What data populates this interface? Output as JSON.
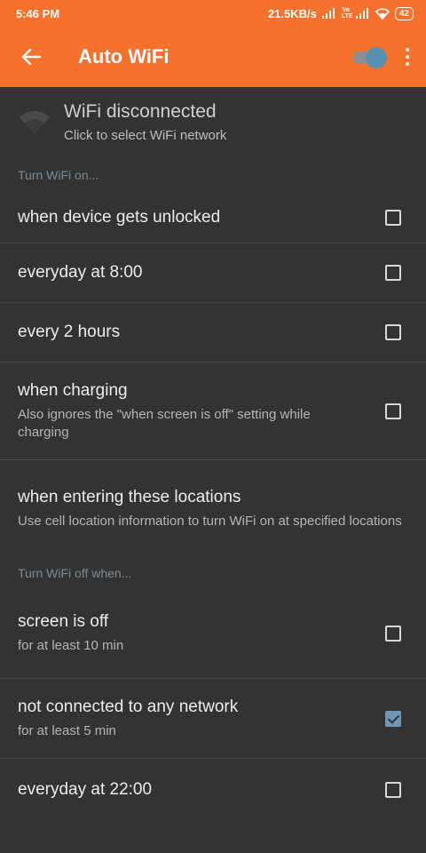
{
  "status_bar": {
    "time": "5:46 PM",
    "speed": "21.5KB/s",
    "network_label": "Vo LTE",
    "battery": "42"
  },
  "app_bar": {
    "title": "Auto WiFi",
    "toggle_on": true
  },
  "wifi_status": {
    "title": "WiFi disconnected",
    "subtitle": "Click to select WiFi network"
  },
  "sections": {
    "turn_on_header": "Turn WiFi on...",
    "turn_off_header": "Turn WiFi off when..."
  },
  "turn_on_items": [
    {
      "label": "when device gets unlocked",
      "checked": false
    },
    {
      "label": "everyday at 8:00",
      "checked": false
    },
    {
      "label": "every 2 hours",
      "checked": false
    },
    {
      "label": "when charging",
      "desc": "Also ignores the \"when screen is off\" setting while charging",
      "checked": false
    },
    {
      "label": "when entering these locations",
      "desc": "Use cell location information to turn WiFi on at specified locations"
    }
  ],
  "turn_off_items": [
    {
      "label": "screen is off",
      "desc": "for at least 10 min",
      "checked": false
    },
    {
      "label": "not connected to any network",
      "desc": "for at least 5 min",
      "checked": true
    },
    {
      "label": "everyday at 22:00",
      "checked": false
    }
  ],
  "colors": {
    "accent": "#f4712e",
    "background": "#333333",
    "checkbox_checked": "#6f97b5"
  }
}
